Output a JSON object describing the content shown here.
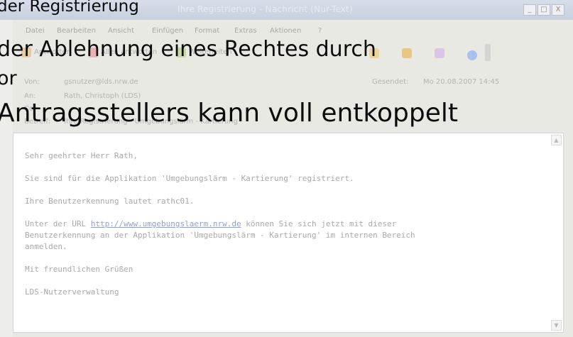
{
  "window": {
    "title": "Ihre Registrierung - Nachricht (Nur-Text)",
    "controls": [
      "_",
      "□",
      "X"
    ]
  },
  "menu": [
    "Datei",
    "Bearbeiten",
    "Ansicht",
    "Einfügen",
    "Format",
    "Extras",
    "Aktionen",
    "?"
  ],
  "toolbar": {
    "reply": "Antworten",
    "reply_all": "Allen antworten",
    "forward": "Weiterleiten"
  },
  "header": {
    "from_label": "Von:",
    "from_value": "gsnutzer@lds.nrw.de",
    "sent_label": "Gesendet:",
    "sent_value": "Mo 20.08.2007 14:45",
    "to_label": "An:",
    "to_value": "Rath, Christoph (LDS)",
    "cc_label": "Cc:",
    "subject_label": "Betreff:",
    "subject_value": "Ihre Registrierung - Umgebungslärm - Kartierung"
  },
  "overlay": {
    "line1": "der Registrierung",
    "line2": "der Ablehnung eines Rechtes durch",
    "line3": "or",
    "line4": "Antragsstellers kann voll entkoppelt"
  },
  "message": {
    "greeting": "Sehr geehrter Herr Rath,",
    "p1": "Sie sind für die Applikation 'Umgebungslärm - Kartierung' registriert.",
    "p2": "Ihre Benutzerkennung lautet rathc01.",
    "p3_pre": "Unter der URL ",
    "p3_link": "http://www.umgebungslaerm.nrw.de",
    "p3_post": " können Sie sich jetzt mit dieser",
    "p3_line2": "Benutzerkennung an der Applikation 'Umgebungslärm - Kartierung' im internen Bereich",
    "p3_line3": "anmelden.",
    "closing": "Mit freundlichen Grüßen",
    "signature": "LDS-Nutzerverwaltung"
  }
}
